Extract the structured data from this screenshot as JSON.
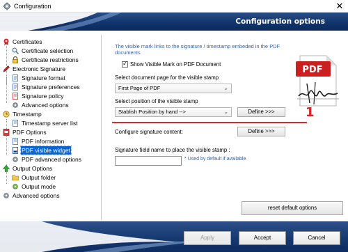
{
  "window": {
    "title": "Configuration",
    "close_glyph": "✕"
  },
  "header": {
    "title": "Configuration options"
  },
  "tree": {
    "items": [
      {
        "label": "Certificates",
        "icon": "certificate-icon"
      },
      {
        "label": "Certificate selection",
        "icon": "magnifier-icon"
      },
      {
        "label": "Certificate restrictions",
        "icon": "lock-icon"
      },
      {
        "label": "Electronic Signature",
        "icon": "pen-icon"
      },
      {
        "label": "Signature format",
        "icon": "document-icon"
      },
      {
        "label": "Signature preferences",
        "icon": "document-icon"
      },
      {
        "label": "Signature policy",
        "icon": "document-icon"
      },
      {
        "label": "Advanced options",
        "icon": "gear-icon"
      },
      {
        "label": "Timestamp",
        "icon": "clock-icon"
      },
      {
        "label": "Timestamp server list",
        "icon": "document-icon"
      },
      {
        "label": "PDF Options",
        "icon": "pdf-icon"
      },
      {
        "label": "PDF information",
        "icon": "document-icon"
      },
      {
        "label": "PDF visible widget",
        "icon": "document-icon"
      },
      {
        "label": "PDF advanced options",
        "icon": "gear-icon"
      },
      {
        "label": "Output Options",
        "icon": "arrow-up-icon"
      },
      {
        "label": "Output folder",
        "icon": "folder-icon"
      },
      {
        "label": "Output mode",
        "icon": "gear-icon"
      },
      {
        "label": "Advanced options",
        "icon": "gear-icon"
      }
    ],
    "selected": "PDF visible widget"
  },
  "panel": {
    "info_text": "The visible mark links to the signature / timestamp embeded in the PDF documents",
    "show_mark_label": "Show Visible Mark on PDF Document",
    "show_mark_checked": true,
    "page_label": "Select document page for the visible stamp",
    "page_value": "First Page of PDF",
    "position_label": "Select position of the visible stamp",
    "position_value": "Stablish Position by hand  -->",
    "define_label": "Define >>>",
    "marker": "1",
    "content_label": "Configure signature content:",
    "content_define_label": "Define >>>",
    "field_label": "Signature field name to place the visible stamp :",
    "field_value": "",
    "field_hint": "* Used by default if available",
    "reset_label": "reset default options",
    "pdf_badge": "PDF"
  },
  "footer": {
    "apply": "Apply",
    "accept": "Accept",
    "cancel": "Cancel"
  },
  "colors": {
    "banner": "#13356d",
    "selection": "#0a64d2",
    "info_text": "#3a60a8",
    "marker": "#e02020"
  }
}
